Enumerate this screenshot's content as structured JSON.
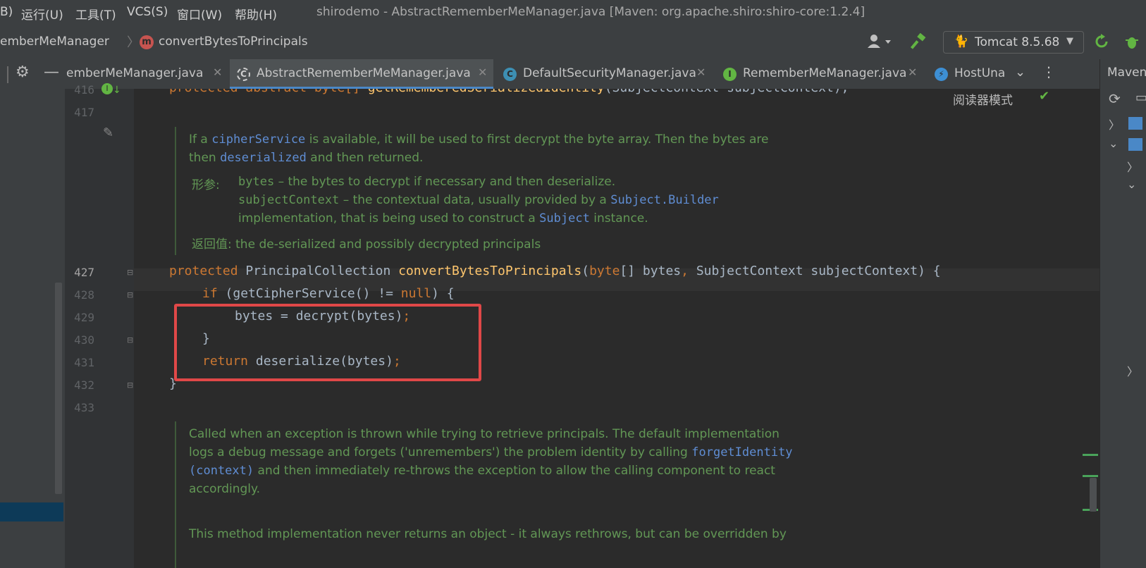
{
  "menu": {
    "items": [
      "B)",
      "运行(U)",
      "工具(T)",
      "VCS(S)",
      "窗口(W)",
      "帮助(H)"
    ]
  },
  "window_title": "shirodemo - AbstractRememberMeManager.java [Maven: org.apache.shiro:shiro-core:1.2.4]",
  "breadcrumb": {
    "class": "emberMeManager",
    "method_badge": "m",
    "method": "convertBytesToPrincipals"
  },
  "run_config": {
    "label": "Tomcat 8.5.68"
  },
  "tabs": [
    {
      "label": "emberMeManager.java",
      "icon": "",
      "active": false
    },
    {
      "label": "AbstractRememberMeManager.java",
      "icon": "C",
      "active": true
    },
    {
      "label": "DefaultSecurityManager.java",
      "icon": "C",
      "active": false
    },
    {
      "label": "RememberMeManager.java",
      "icon": "I",
      "active": false
    },
    {
      "label": "HostUna",
      "icon": "⚡",
      "active": false
    }
  ],
  "right_panel": {
    "title": "Maven"
  },
  "editor": {
    "reader_mode": "阅读器模式",
    "line_numbers": [
      "416",
      "417",
      "427",
      "428",
      "429",
      "430",
      "431",
      "432",
      "433"
    ],
    "line416": {
      "kw": "protected abstract byte[] ",
      "fn": "getRememberedSerializedIdentity",
      "rest": "(SubjectContext subjectContext);"
    },
    "doc1": {
      "l1a": "If a ",
      "l1code": "cipherService",
      "l1b": " is available, it will be used to first decrypt the byte array. Then the bytes are",
      "l2a": "then ",
      "l2code": "deserialized",
      "l2b": " and then returned.",
      "params_label": "形参:",
      "p1code": "bytes",
      "p1text": " – the bytes to decrypt if necessary and then deserialize.",
      "p2code": "subjectContext",
      "p2a": " – the contextual data, usually provided by a ",
      "p2code2": "Subject.Builder",
      "p3a": "implementation, that is being used to construct a ",
      "p3code": "Subject",
      "p3b": " instance.",
      "returns_label": "返回值:",
      "returns_text": " the de-serialized and possibly decrypted principals"
    },
    "line427": {
      "kw1": "protected ",
      "type": "PrincipalCollection ",
      "fn": "convertBytesToPrincipals",
      "p1": "(",
      "kw2": "byte",
      "p2": "[] bytes",
      "comma": ", ",
      "p3": "SubjectContext subjectContext) {"
    },
    "line428": {
      "kw": "if ",
      "p1": "(getCipherService() != ",
      "kw2": "null",
      "p2": ") {"
    },
    "line429": {
      "text": "bytes = decrypt(bytes)",
      "semi": ";"
    },
    "line430": {
      "text": "}"
    },
    "line431": {
      "kw": "return ",
      "text": "deserialize(bytes)",
      "semi": ";"
    },
    "line432": {
      "text": "}"
    },
    "doc2": {
      "l1": "Called when an exception is thrown while trying to retrieve principals. The default implementation",
      "l2a": "logs a debug message and forgets ('unremembers') the problem identity by calling ",
      "l2code": "forgetIdentity",
      "l3code": "(context)",
      "l3b": " and then immediately re-throws the exception to allow the calling component to react",
      "l4": "accordingly.",
      "l5": "This method implementation never returns an object - it always rethrows, but can be overridden by"
    }
  }
}
